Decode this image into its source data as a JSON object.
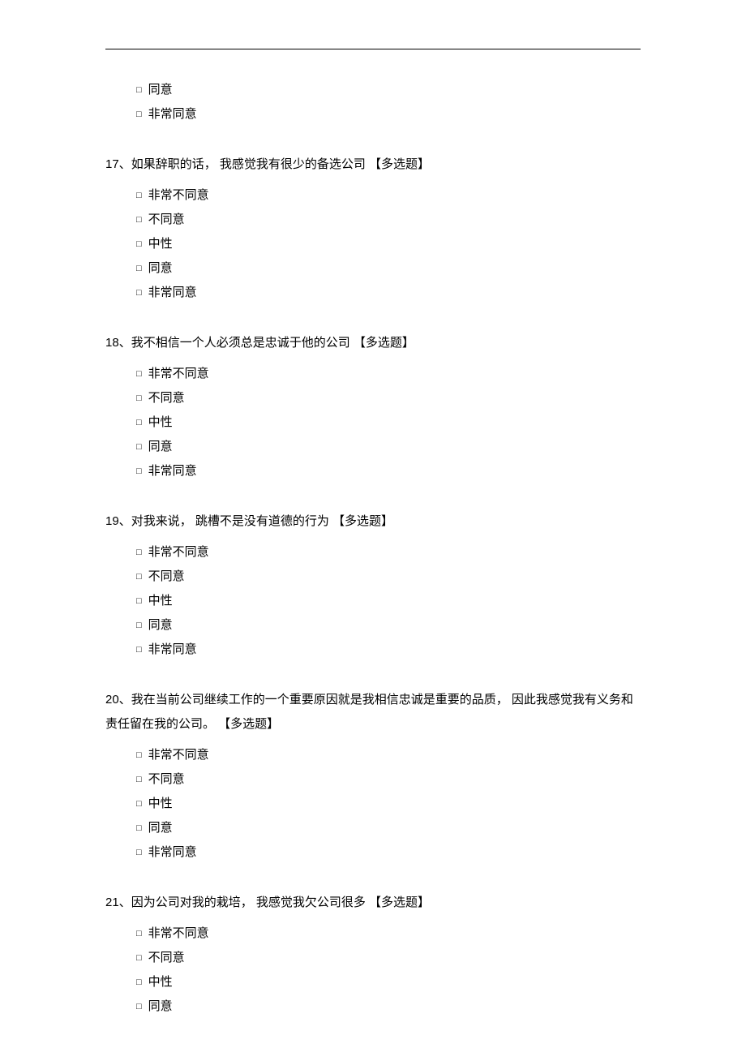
{
  "checkbox_symbol": "□",
  "multi_choice_tag": "【多选题】",
  "orphan_options": [
    "同意",
    "非常同意"
  ],
  "questions": [
    {
      "number": "17、",
      "text": "如果辞职的话，  我感觉我有很少的备选公司",
      "options": [
        "非常不同意",
        "不同意",
        "中性",
        "同意",
        "非常同意"
      ]
    },
    {
      "number": "18、",
      "text": "我不相信一个人必须总是忠诚于他的公司",
      "options": [
        "非常不同意",
        "不同意",
        "中性",
        "同意",
        "非常同意"
      ]
    },
    {
      "number": "19、",
      "text": "对我来说，  跳槽不是没有道德的行为",
      "options": [
        "非常不同意",
        "不同意",
        "中性",
        "同意",
        "非常同意"
      ]
    },
    {
      "number": "20、",
      "text": "我在当前公司继续工作的一个重要原因就是我相信忠诚是重要的品质，  因此我感觉我有义务和责任留在我的公司。 ",
      "options": [
        "非常不同意",
        "不同意",
        "中性",
        "同意",
        "非常同意"
      ]
    },
    {
      "number": "21、",
      "text": "因为公司对我的栽培，  我感觉我欠公司很多",
      "options": [
        "非常不同意",
        "不同意",
        "中性",
        "同意"
      ]
    }
  ]
}
